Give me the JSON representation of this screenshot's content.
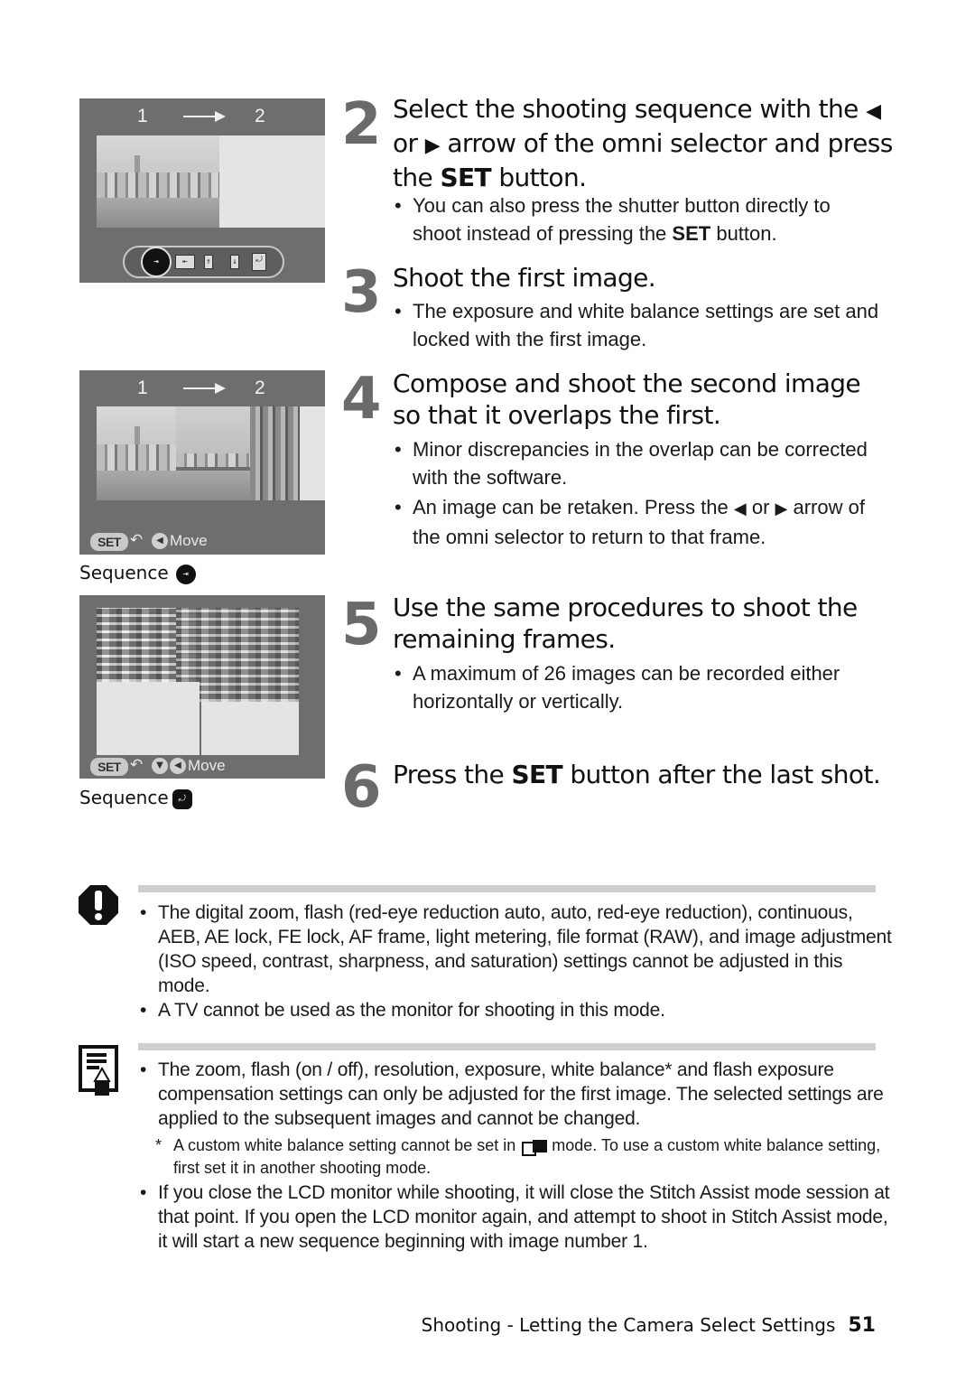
{
  "screens": [
    {
      "seq_from": "1",
      "seq_to": "2",
      "mode_icons": [
        "left-to-right",
        "right-to-left",
        "bottom-to-top",
        "top-to-bottom",
        "clockwise"
      ],
      "selected_mode": "left-to-right"
    },
    {
      "seq_from": "1",
      "seq_to": "2",
      "set_label": "SET",
      "move_label": "Move",
      "caption": "Sequence",
      "caption_icon": "left-to-right-sequence-icon"
    },
    {
      "set_label": "SET",
      "move_label": "Move",
      "caption": "Sequence",
      "caption_icon": "clockwise-sequence-icon"
    }
  ],
  "steps": [
    {
      "number": "2",
      "title_parts": [
        "Select the shooting sequence with the ",
        "◀",
        " or ",
        "▶",
        " arrow of the omni selector and press the ",
        "SET",
        " button."
      ],
      "bullets": [
        {
          "parts": [
            "You can also press the shutter button directly to shoot instead of pressing the ",
            "SET",
            " button."
          ]
        }
      ]
    },
    {
      "number": "3",
      "title": "Shoot the first image.",
      "bullets": [
        {
          "text": "The exposure and white balance settings are set and locked with the first image."
        }
      ]
    },
    {
      "number": "4",
      "title": "Compose and shoot the second image so that it overlaps the first.",
      "bullets": [
        {
          "text": "Minor discrepancies in the overlap can be corrected with the software."
        },
        {
          "parts": [
            "An image can be retaken. Press the ",
            "◀",
            " or ",
            "▶",
            " arrow of the omni selector to return to that frame."
          ]
        }
      ]
    },
    {
      "number": "5",
      "title": "Use the same procedures to shoot the remaining frames.",
      "bullets": [
        {
          "text": "A maximum of 26 images can be recorded either horizontally or vertically."
        }
      ]
    },
    {
      "number": "6",
      "title_parts": [
        "Press the ",
        "SET",
        " button after the last shot."
      ]
    }
  ],
  "caution": {
    "icon": "caution-icon",
    "bullets": [
      "The digital zoom, flash (red-eye reduction auto, auto, red-eye reduction), continuous, AEB, AE lock, FE lock, AF frame, light metering, file format (RAW), and image adjustment (ISO speed, contrast, sharpness, and saturation) settings cannot be adjusted in this mode.",
      "A TV cannot be used as the monitor for shooting in this mode."
    ]
  },
  "memo": {
    "icon": "memo-icon",
    "bullets": [
      "The zoom, flash (on / off), resolution, exposure, white balance* and flash exposure compensation settings can only be adjusted for the first image. The selected settings are applied to the subsequent images and cannot be changed.",
      "If you close the LCD monitor while shooting, it will close the Stitch Assist mode session at that point. If you open the LCD monitor again, and attempt to shoot in Stitch Assist mode, it will start a new sequence beginning with image number 1."
    ],
    "footnote_before": "A custom white balance setting cannot be set in ",
    "footnote_after": " mode. To use a custom white balance setting, first set it in another shooting mode."
  },
  "footer": {
    "section": "Shooting - Letting the Camera Select Settings",
    "page": "51"
  }
}
